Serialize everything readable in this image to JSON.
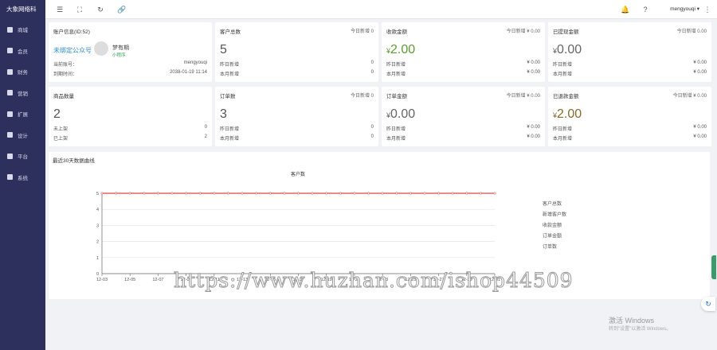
{
  "brand": "大象网络科",
  "sidebar": {
    "items": [
      {
        "label": "商城",
        "icon": "store-icon"
      },
      {
        "label": "会员",
        "icon": "user-icon"
      },
      {
        "label": "财务",
        "icon": "finance-icon"
      },
      {
        "label": "营销",
        "icon": "megaphone-icon"
      },
      {
        "label": "扩展",
        "icon": "flag-icon"
      },
      {
        "label": "设计",
        "icon": "puzzle-icon"
      },
      {
        "label": "平台",
        "icon": "grid-icon"
      },
      {
        "label": "系统",
        "icon": "monitor-icon"
      }
    ]
  },
  "topbar": {
    "icons": [
      "menu-icon",
      "fullscreen-icon",
      "refresh-icon",
      "link-icon"
    ],
    "username": "mengyouqi",
    "right_icons": [
      "bell-icon",
      "help-icon",
      "more-icon"
    ]
  },
  "account": {
    "title": "账户信息(ID:52)",
    "bind_link": "未绑定公众号",
    "nickname": "梦有期",
    "tag": "小程序",
    "account_label": "当前账号：",
    "account_value": "mengyouqi",
    "expire_label": "到期时间：",
    "expire_value": "2038-01-19 11:14"
  },
  "cards": [
    {
      "title": "客户总数",
      "right": "今日新增 0",
      "big": "5",
      "r1l": "昨日新增",
      "r1v": "0",
      "r2l": "本月新增",
      "r2v": "0"
    },
    {
      "title": "收款金额",
      "right": "今日新增 ¥ 0.00",
      "big_cur": "¥",
      "big": "2.00",
      "r1l": "昨日新增",
      "r1v": "¥ 0.00",
      "r2l": "本月新增",
      "r2v": "¥ 0.00"
    },
    {
      "title": "已提现金额",
      "right": "今日新增 0.00",
      "big_cur": "¥",
      "big": "0.00",
      "r1l": "昨日新增",
      "r1v": "¥ 0.00",
      "r2l": "本月新增",
      "r2v": "¥ 0.00"
    },
    {
      "title": "商品数量",
      "big": "2",
      "r1l": "未上架",
      "r1v": "0",
      "r2l": "已上架",
      "r2v": "2"
    },
    {
      "title": "订单数",
      "right": "今日新增 0",
      "big": "3",
      "r1l": "昨日新增",
      "r1v": "0",
      "r2l": "本月新增",
      "r2v": "0"
    },
    {
      "title": "订单金额",
      "right": "今日新增 ¥ 0.00",
      "big_cur": "¥",
      "big": "0.00",
      "r1l": "昨日新增",
      "r1v": "¥ 0.00",
      "r2l": "本月新增",
      "r2v": "¥ 0.00"
    },
    {
      "title": "已退款金额",
      "right": "今日新增 ¥ 0.00",
      "big_cur": "¥",
      "big": "2.00",
      "r1l": "昨日新增",
      "r1v": "¥ 0.00",
      "r2l": "本月新增",
      "r2v": "¥ 0.00"
    }
  ],
  "chart_card": {
    "title": "最近30天数据曲线"
  },
  "chart_data": {
    "type": "line",
    "title": "客户数",
    "x": [
      "12-03",
      "12-05",
      "12-07",
      "12-09",
      "12-11",
      "12-13",
      "12-15",
      "12-17",
      "12-19",
      "12-21",
      "12-23",
      "12-25",
      "12-27",
      "12-29",
      "12-31"
    ],
    "x_count": 29,
    "ylim": [
      0,
      5
    ],
    "yticks": [
      0,
      1,
      2,
      3,
      4,
      5
    ],
    "series": [
      {
        "name": "客户数",
        "value": 5,
        "color": "#e06666"
      }
    ],
    "legend": [
      "客户总数",
      "新增客户数",
      "收款金额",
      "订单金额",
      "订单数"
    ],
    "legend_position": "right",
    "grid": true
  },
  "watermark": "https://www.huzhan.com/ishop44509",
  "windows": {
    "line1": "激活 Windows",
    "line2": "转到\"设置\"以激活 Windows。"
  }
}
